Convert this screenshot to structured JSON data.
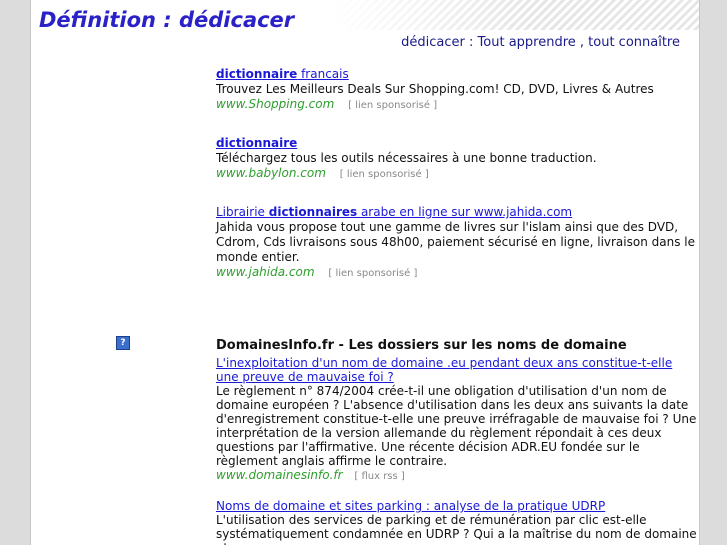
{
  "header": {
    "title": "Définition : dédicacer",
    "subtitle": "dédicacer : Tout apprendre , tout connaître"
  },
  "ads": [
    {
      "link_bold": "dictionnaire",
      "link_rest": " francais",
      "description": "Trouvez Les Meilleurs Deals Sur Shopping.com! CD, DVD, Livres & Autres",
      "site": "www.Shopping.com",
      "tag": "[ lien sponsorisé ]"
    },
    {
      "link_bold": "dictionnaire",
      "link_rest": "",
      "description": "Téléchargez tous les outils nécessaires à une bonne traduction.",
      "site": "www.babylon.com",
      "tag": "[ lien sponsorisé ]"
    },
    {
      "link_pre": "Librairie ",
      "link_bold": "dictionnaires",
      "link_rest": " arabe en ligne sur www.jahida.com",
      "description": "Jahida vous propose tout une gamme de livres sur l'islam ainsi que des DVD, Cdrom, Cds livraisons sous 48h00, paiement sécurisé en ligne, livraison dans le monde entier.",
      "site": "www.jahida.com",
      "tag": "[ lien sponsorisé ]"
    }
  ],
  "help_icon": {
    "glyph": "?"
  },
  "feed": {
    "heading": "DomainesInfo.fr - Les dossiers sur les noms de domaine",
    "items": [
      {
        "title": "L'inexploitation d'un nom de domaine .eu pendant deux ans constitue-t-elle une preuve de mauvaise foi ?",
        "description": "Le règlement n° 874/2004 crée-t-il une obligation d'utilisation d'un nom de domaine européen ? L'absence d'utilisation dans les deux ans suivants la date d'enregistrement constitue-t-elle une preuve irréfragable de mauvaise foi ? Une interprétation de la version allemande du règlement répondait à ces deux questions par l'affirmative. Une récente décision ADR.EU fondée sur le règlement anglais affirme le contraire.",
        "site": "www.domainesinfo.fr",
        "tag": "[ flux rss ]"
      },
      {
        "title": "Noms de domaine et sites parking : analyse de la pratique UDRP",
        "description": "L'utilisation des services de parking et de rémunération par clic est-elle systématiquement condamnée en UDRP ? Qui a la maîtrise du nom de domaine et"
      }
    ]
  },
  "colors": {
    "title": "#2a22c8",
    "subtitle": "#1a1a8a",
    "link": "#1a1ad6",
    "site": "#2e9e2e",
    "muted": "#888888"
  }
}
